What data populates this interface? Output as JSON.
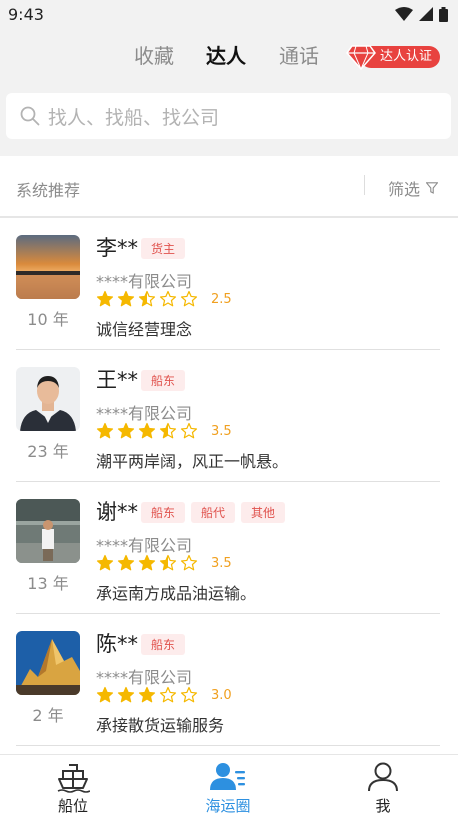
{
  "status_bar": {
    "time": "9:43"
  },
  "top_tabs": {
    "favorites": "收藏",
    "experts": "达人",
    "calls": "通话",
    "active": "达人"
  },
  "verify_badge": {
    "label": "达人认证"
  },
  "search": {
    "placeholder": "找人、找船、找公司"
  },
  "filter_bar": {
    "title": "系统推荐",
    "filter_label": "筛选"
  },
  "experts": [
    {
      "name": "李**",
      "tags": [
        "货主"
      ],
      "company": "****有限公司",
      "rating": 2.5,
      "rating_text": "2.5",
      "years": "10 年",
      "motto": "诚信经营理念",
      "avatar": "sunset"
    },
    {
      "name": "王**",
      "tags": [
        "船东"
      ],
      "company": "****有限公司",
      "rating": 3.5,
      "rating_text": "3.5",
      "years": "23 年",
      "motto": "潮平两岸阔，风正一帆悬。",
      "avatar": "portrait"
    },
    {
      "name": "谢**",
      "tags": [
        "船东",
        "船代",
        "其他"
      ],
      "company": "****有限公司",
      "rating": 3.5,
      "rating_text": "3.5",
      "years": "13 年",
      "motto": "承运南方成品油运输。",
      "avatar": "warehouse"
    },
    {
      "name": "陈**",
      "tags": [
        "船东"
      ],
      "company": "****有限公司",
      "rating": 3.0,
      "rating_text": "3.0",
      "years": "2 年",
      "motto": "承接散货运输服务",
      "avatar": "mountain"
    }
  ],
  "bottom_nav": {
    "berth": "船位",
    "circle": "海运圈",
    "me": "我",
    "active": "海运圈"
  },
  "colors": {
    "accent": "#2d90e0",
    "star": "#f5b800",
    "tag_text": "#e0524d",
    "badge": "#e8423f"
  }
}
